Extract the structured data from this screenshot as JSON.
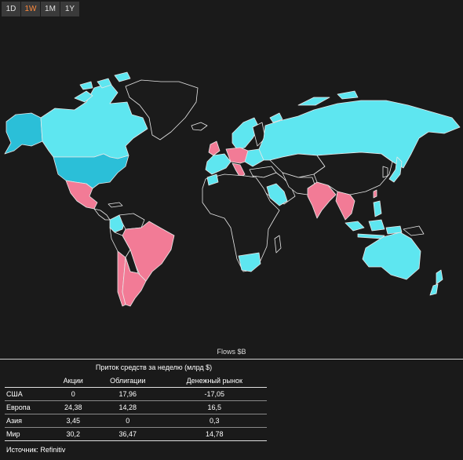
{
  "timeframe_tabs": [
    {
      "label": "1D",
      "active": false
    },
    {
      "label": "1W",
      "active": true
    },
    {
      "label": "1M",
      "active": false
    },
    {
      "label": "1Y",
      "active": false
    }
  ],
  "colors": {
    "background": "#1a1a1a",
    "land": "#1b1b1b",
    "inflow": "#5ee6f0",
    "outflow": "#f27b96",
    "usa": "#2bbfd8",
    "border": "#e8e8e8",
    "active_tab": "#ff8a3d"
  },
  "map": {
    "caption": "Flows $B"
  },
  "table": {
    "title": "Приток средств за неделю (млрд $)",
    "headers": [
      "",
      "Акции",
      "Облигации",
      "Денежный рынок"
    ],
    "rows": [
      [
        "США",
        "0",
        "17,96",
        "-17,05"
      ],
      [
        "Европа",
        "24,38",
        "14,28",
        "16,5"
      ],
      [
        "Азия",
        "3,45",
        "0",
        "0,3"
      ],
      [
        "Мир",
        "30,2",
        "36,47",
        "14,78"
      ]
    ]
  },
  "source": "Источник: Refinitiv"
}
